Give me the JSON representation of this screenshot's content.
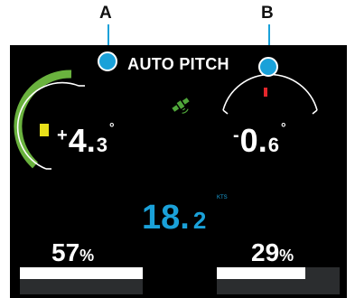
{
  "callouts": {
    "a": "A",
    "b": "B",
    "color": "#1aa1d9"
  },
  "screen": {
    "title": "AUTO PITCH",
    "status_icon": "satellite-icon",
    "left_gauge": {
      "sign": "+",
      "int": "4.",
      "frac": "3",
      "deg": "°"
    },
    "right_gauge": {
      "sign": "-",
      "int": "0.",
      "frac": "6",
      "deg": "°"
    },
    "speed": {
      "int": "18.",
      "frac": "2",
      "unit": "KTS"
    },
    "left_tab": {
      "value": "57",
      "symbol": "%",
      "level": 0.57
    },
    "right_tab": {
      "value": "29",
      "symbol": "%",
      "level": 0.29
    },
    "colors": {
      "accent": "#1aa1d9",
      "gauge_green": "#6ab23e",
      "indicator_yellow": "#e8e01a",
      "indicator_red": "#e3262b",
      "icon_green": "#4fa63a"
    }
  }
}
